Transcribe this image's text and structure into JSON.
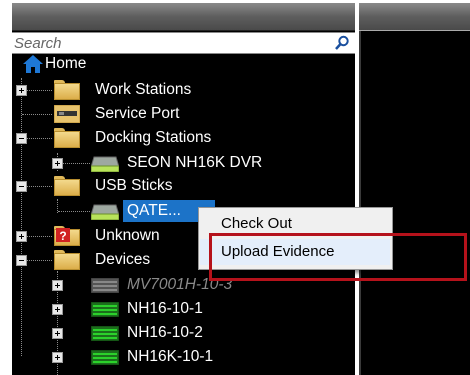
{
  "search": {
    "placeholder": "Search"
  },
  "tree": {
    "home": "Home",
    "work_stations": "Work Stations",
    "service_port": "Service Port",
    "docking_stations": "Docking Stations",
    "dock_device": "SEON NH16K DVR",
    "usb_sticks": "USB Sticks",
    "usb_selected": "QATE...",
    "unknown": "Unknown",
    "devices": "Devices",
    "device_items": [
      "MV7001H-10-3",
      "NH16-10-1",
      "NH16-10-2",
      "NH16K-10-1"
    ]
  },
  "context_menu": {
    "items": [
      "Check Out",
      "Upload Evidence"
    ]
  },
  "colors": {
    "selection": "#1c73c8",
    "highlight_border": "#b5121b",
    "home_icon": "#1e78d6",
    "device_green": "#2bd12b",
    "unknown_badge": "#d12222"
  }
}
